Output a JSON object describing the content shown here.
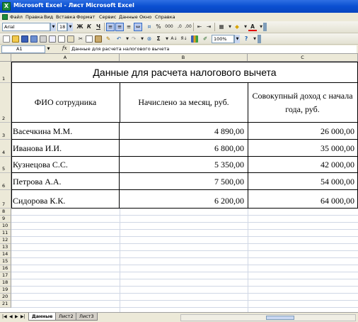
{
  "window": {
    "title": "Microsoft Excel - Лист Microsoft Excel"
  },
  "menu": [
    "Файл",
    "Правка",
    "Вид",
    "Вставка",
    "Формат",
    "Сервис",
    "Данные",
    "Окно",
    "Справка"
  ],
  "toolbar1": {
    "font_name": "Arial",
    "font_size": "18",
    "bold_label": "Ж",
    "italic_label": "К",
    "underline_label": "Ч",
    "percent_label": "%",
    "thousands_label": "000",
    "font_color_label": "A"
  },
  "toolbar2": {
    "zoom": "100%",
    "sum_label": "Σ"
  },
  "formula_bar": {
    "name_box": "A1",
    "fx_label": "fx",
    "content": "Данные для расчета налогового вычета"
  },
  "columns": [
    "A",
    "B",
    "C"
  ],
  "rows": [
    "1",
    "2",
    "3",
    "4",
    "5",
    "6",
    "7",
    "8",
    "9",
    "10",
    "11",
    "12",
    "13",
    "14",
    "15",
    "16",
    "17",
    "18",
    "19",
    "20",
    "21"
  ],
  "sheet": {
    "title": "Данные для расчета налогового вычета",
    "headers": [
      "ФИО сотрудника",
      "Начислено за месяц, руб.",
      "Совокупный доход с начала года, руб."
    ],
    "rows": [
      {
        "name": "Васечкина М.М.",
        "monthly": "4 890,00",
        "cumulative": "26 000,00"
      },
      {
        "name": "Иванова И.И.",
        "monthly": "6 800,00",
        "cumulative": "35 000,00"
      },
      {
        "name": "Кузнецова С.С.",
        "monthly": "5 350,00",
        "cumulative": "42 000,00"
      },
      {
        "name": "Петрова А.А.",
        "monthly": "7 500,00",
        "cumulative": "54 000,00"
      },
      {
        "name": "Сидорова К.К.",
        "monthly": "6 200,00",
        "cumulative": "64 000,00"
      }
    ]
  },
  "tabs": [
    "Данные",
    "Лист2",
    "Лист3"
  ],
  "colors": {
    "titlebar": "#0a4fd1",
    "chrome": "#ece9d8",
    "gridline": "#d0d7e5"
  }
}
